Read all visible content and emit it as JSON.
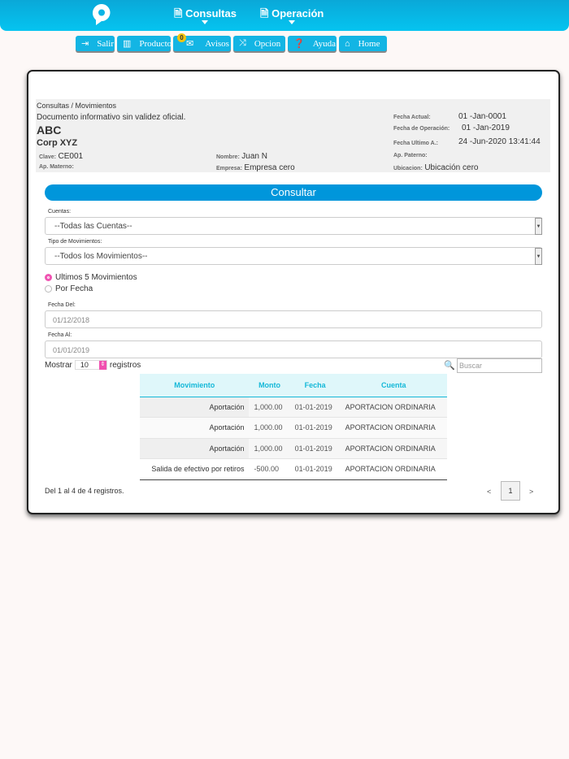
{
  "header": {
    "menus": [
      {
        "label": "Consultas",
        "icon": "document-icon"
      },
      {
        "label": "Operación",
        "icon": "document-icon"
      }
    ]
  },
  "nav": {
    "buttons": [
      {
        "label": "Salir",
        "icon": "exit-icon"
      },
      {
        "label": "Producto",
        "icon": "chart-icon"
      },
      {
        "label": "Avisos",
        "icon": "envelope-icon",
        "badge": "0"
      },
      {
        "label": "Opcion",
        "icon": "shuffle-icon"
      },
      {
        "label": "Ayuda",
        "icon": "question-icon"
      },
      {
        "label": "Home",
        "icon": "home-icon"
      }
    ]
  },
  "info": {
    "breadcrumb": "Consultas / Movimientos",
    "notice": "Documento informativo sin validez oficial.",
    "company": "ABC",
    "corp": "Corp XYZ",
    "clave_label": "Clave:",
    "clave": "CE001",
    "nombre_label": "Nombre:",
    "nombre": "Juan N",
    "paterno_label": "Ap. Paterno:",
    "paterno": "",
    "materno_label": "Ap. Materno:",
    "materno": "",
    "empresa_label": "Empresa:",
    "empresa": "Empresa cero",
    "ubicacion_label": "Ubicacion:",
    "ubicacion": "Ubicación cero",
    "fecha_actual_label": "Fecha Actual:",
    "fecha_actual": "01 -Jan-0001",
    "fecha_op_label": "Fecha de Operación:",
    "fecha_op": "01 -Jan-2019",
    "fecha_ult_label": "Fecha Ultimo A.:",
    "fecha_ult": "24 -Jun-2020 13:41:44"
  },
  "form": {
    "submit": "Consultar",
    "cuentas_label": "Cuentas:",
    "cuentas_value": "--Todas las Cuentas--",
    "tipo_label": "Tipo de Movimientos:",
    "tipo_value": "--Todos los Movimientos--",
    "radio1": "Ultimos 5 Movimientos",
    "radio2": "Por Fecha",
    "radio_selected": "Ultimos 5 Movimientos",
    "fecha_del_label": "Fecha Del:",
    "fecha_del": "01/12/2018",
    "fecha_al_label": "Fecha Al:",
    "fecha_al": "01/01/2019"
  },
  "table": {
    "show_label": "Mostrar",
    "page_size": "10",
    "records_label": "registros",
    "search_placeholder": "Buscar",
    "headers": [
      "Movimiento",
      "Monto",
      "Fecha",
      "Cuenta"
    ],
    "rows": [
      [
        "Aportación",
        "1,000.00",
        "01-01-2019",
        "APORTACION ORDINARIA"
      ],
      [
        "Aportación",
        "1,000.00",
        "01-01-2019",
        "APORTACION ORDINARIA"
      ],
      [
        "Aportación",
        "1,000.00",
        "01-01-2019",
        "APORTACION ORDINARIA"
      ],
      [
        "Salida de efectivo por retiros",
        "-500.00",
        "01-01-2019",
        "APORTACION ORDINARIA"
      ]
    ],
    "summary": "Del 1 al 4 de 4 registros.",
    "prev": "<",
    "page": "1",
    "next": ">"
  }
}
